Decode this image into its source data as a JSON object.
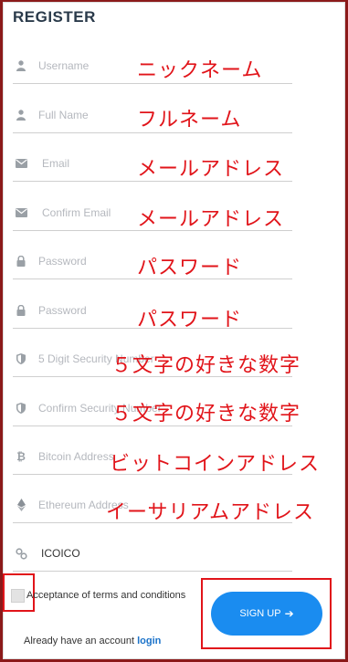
{
  "title": "REGISTER",
  "fields": [
    {
      "name": "username",
      "icon": "user-icon",
      "placeholder": "Username",
      "annotation": "ニックネーム"
    },
    {
      "name": "full-name",
      "icon": "user-icon",
      "placeholder": "Full Name",
      "annotation": "フルネーム"
    },
    {
      "name": "email",
      "icon": "envelope-icon",
      "placeholder": "Email",
      "annotation": "メールアドレス"
    },
    {
      "name": "confirm-email",
      "icon": "envelope-icon",
      "placeholder": "Confirm Email",
      "annotation": "メールアドレス"
    },
    {
      "name": "password",
      "icon": "lock-icon",
      "placeholder": "Password",
      "annotation": "パスワード"
    },
    {
      "name": "confirm-password",
      "icon": "lock-icon",
      "placeholder": "Password",
      "annotation": "パスワード"
    },
    {
      "name": "security-number",
      "icon": "shield-icon",
      "placeholder": "5 Digit Security Number",
      "annotation": "５文字の好きな数字"
    },
    {
      "name": "confirm-security-number",
      "icon": "shield-icon",
      "placeholder": "Confirm Security Number",
      "annotation": "５文字の好きな数字"
    },
    {
      "name": "bitcoin-address",
      "icon": "bitcoin-icon",
      "placeholder": "Bitcoin Address",
      "annotation": "ビットコインアドレス"
    },
    {
      "name": "ethereum-address",
      "icon": "ethereum-icon",
      "placeholder": "Ethereum Address",
      "annotation": "イーサリアムアドレス"
    },
    {
      "name": "referral",
      "icon": "link-icon",
      "value": "ICOICO"
    }
  ],
  "terms_label": "Acceptance of terms and conditions",
  "signup_label": "SIGN UP",
  "signup_arrow": "➔",
  "account_text": "Already have an account",
  "login_link": "login",
  "colors": {
    "accent": "#1a8cf0",
    "annotation": "#e1141a",
    "frame": "#8b1a1a"
  }
}
